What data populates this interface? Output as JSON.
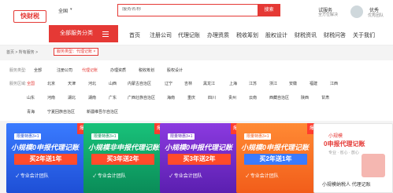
{
  "header": {
    "logo": "快财税",
    "city": "全国",
    "search_placeholder": "服务名称",
    "search_button": "搜索",
    "consult_title": "试服务",
    "consult_sub": "全方位解决",
    "user_label": "优秀",
    "user_sub": "优秀团队"
  },
  "nav": {
    "category_button": "全部服务分类",
    "items": [
      "首页",
      "注册公司",
      "代理记账",
      "办理资质",
      "税收筹划",
      "股权设计",
      "财税资讯",
      "财税问答",
      "关于我们"
    ]
  },
  "breadcrumb": {
    "path": "首页 > 所有服务 >",
    "tag": "服务类型：代理记账 ×"
  },
  "filters": {
    "service_label": "服务类型:",
    "service_items": [
      "全部",
      "注册公司",
      "代理记账",
      "办理资质",
      "税收筹划",
      "股权设计"
    ],
    "service_active": 2,
    "region_label": "服务区域:",
    "region_rows": [
      [
        "全国",
        "北京",
        "天津",
        "河北",
        "山西",
        "内蒙古自治区",
        "辽宁",
        "吉林",
        "黑龙江",
        "上海",
        "江苏",
        "浙江",
        "安徽",
        "福建",
        "江西"
      ],
      [
        "山东",
        "河南",
        "湖北",
        "湖南",
        "广东",
        "广西壮族自治区",
        "海南",
        "重庆",
        "四川",
        "贵州",
        "云南",
        "西藏自治区",
        "陕西",
        "甘肃"
      ],
      [
        "青海",
        "宁夏回族自治区",
        "新疆维吾尔自治区"
      ]
    ],
    "region_active": 0
  },
  "cards": [
    {
      "tag": "限量特惠3+1",
      "badge": "爆",
      "title": "小规模0申报代理记账",
      "box": "买2年送1年",
      "foot": "✓ 专业会计团队",
      "style": "blue",
      "boxcolor": "#ff4b2b"
    },
    {
      "tag": "限量特惠3+1",
      "badge": "爆",
      "title": "小规模非申报代理记账",
      "box": "买3年送2年",
      "foot": "✓ 专业会计团队",
      "style": "green",
      "boxcolor": "#ff4b2b"
    },
    {
      "tag": "限量特惠3+1",
      "badge": "爆",
      "title": "小规模0申报代理记账",
      "box": "买3年送2年",
      "foot": "✓ 专业会计团队",
      "style": "purple",
      "boxcolor": "#ff4b2b"
    },
    {
      "tag": "限量特惠3+1",
      "badge": "爆",
      "title": "小规模0申报代理记账",
      "box": "买2年送1年",
      "foot": "✓ 专业会计团队",
      "style": "orange",
      "boxcolor": "#3a7bff"
    }
  ],
  "last_card": {
    "title": "小规模",
    "main": "0申报代理记账",
    "sub": "专业 · 省心 · 放心",
    "foot": "小规模纳税人 代理记账"
  }
}
